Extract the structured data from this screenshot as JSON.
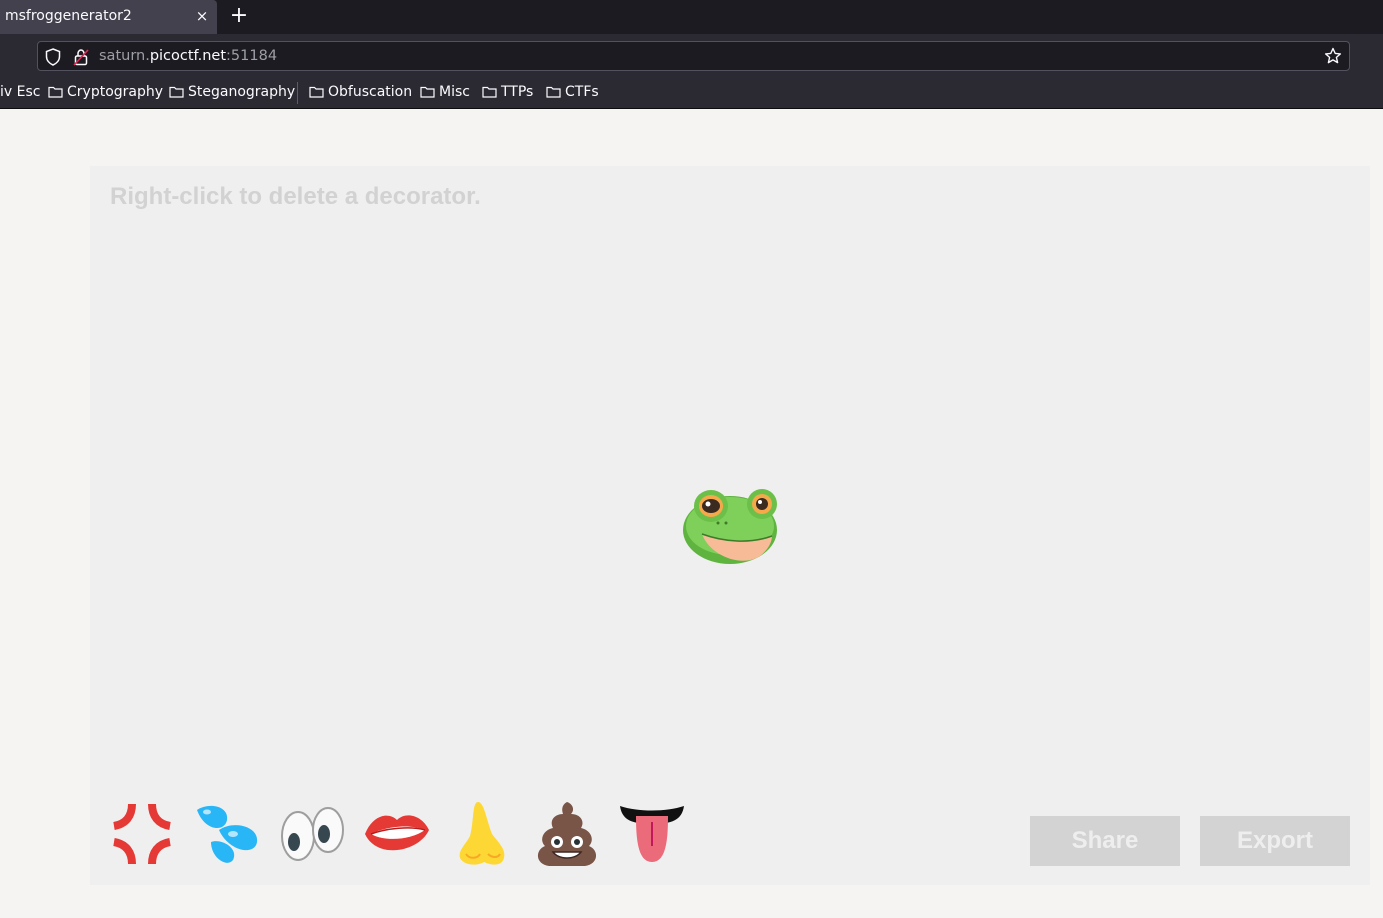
{
  "browser": {
    "tab_title": "msfroggenerator2",
    "tab_close": "×",
    "new_tab": "+",
    "url_prefix": "saturn.",
    "url_host": "picoctf.net",
    "url_port": ":51184",
    "bookmarks": [
      "iv Esc",
      "Cryptography",
      "Steganography",
      "Obfuscation",
      "Misc",
      "TTPs",
      "CTFs"
    ]
  },
  "page": {
    "hint": "Right-click to delete a decorator.",
    "share_label": "Share",
    "export_label": "Export",
    "decorators": [
      "anger-icon",
      "sweat-droplets-icon",
      "eyes-icon",
      "lips-icon",
      "nose-icon",
      "poop-icon",
      "tongue-icon"
    ]
  },
  "colors": {
    "button_bg": "#d3d3d3",
    "button_text": "#eeeeee",
    "canvas_bg": "#f0efef",
    "frog_green": "#6cc04a"
  }
}
